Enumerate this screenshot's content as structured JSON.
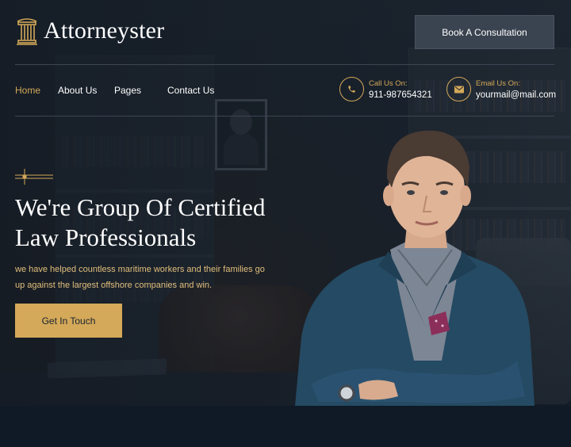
{
  "brand": {
    "name": "Attorneyster"
  },
  "header": {
    "cta_label": "Book A Consultation",
    "nav": [
      {
        "label": "Home",
        "active": true
      },
      {
        "label": "About Us",
        "active": false
      },
      {
        "label": "Pages",
        "active": false
      },
      {
        "label": "Contact Us",
        "active": false
      }
    ],
    "phone": {
      "label": "Call Us On:",
      "value": "911-987654321",
      "icon": "phone-icon"
    },
    "email": {
      "label": "Email Us On:",
      "value": "yourmail@mail.com",
      "icon": "mail-icon"
    }
  },
  "hero": {
    "headline_line1": "We're Group Of Certified",
    "headline_line2": "Law Professionals",
    "description_line1": "we have helped countless maritime workers and their families go",
    "description_line2": "up against the largest offshore companies and win.",
    "cta_label": "Get In Touch"
  },
  "colors": {
    "accent": "#d4a959",
    "background": "#1b242f",
    "button_dark": "#3a4350",
    "footer": "#0f1a26"
  }
}
